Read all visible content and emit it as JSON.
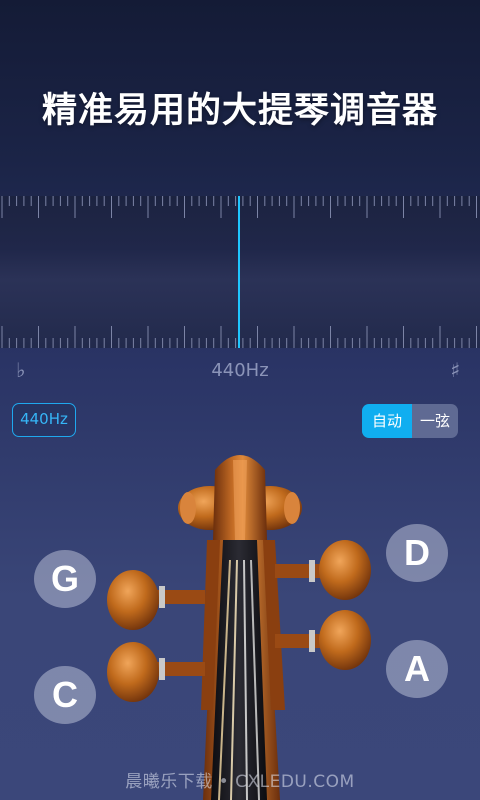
{
  "headline": "精准易用的大提琴调音器",
  "tuner": {
    "flat_symbol": "♭",
    "frequency_label": "440Hz",
    "sharp_symbol": "♯"
  },
  "controls": {
    "reference_button": "440Hz",
    "mode_auto": "自动",
    "mode_single_string": "一弦"
  },
  "strings": {
    "g": "G",
    "c": "C",
    "d": "D",
    "a": "A"
  },
  "watermark": "晨曦乐下载 • CXLEDU.COM",
  "colors": {
    "accent": "#10aef0",
    "needle": "#1fc6ff",
    "violin_wood": "#b35e1d"
  }
}
